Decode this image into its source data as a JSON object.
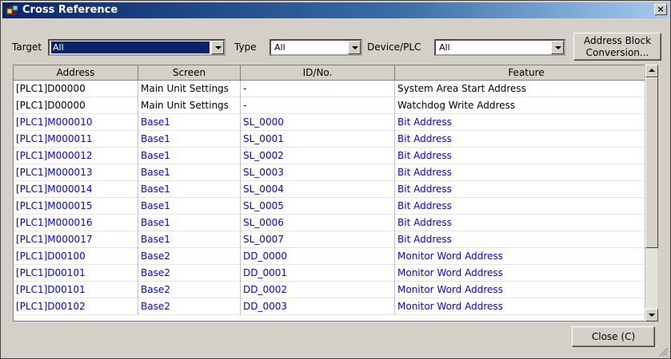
{
  "window": {
    "title": "Cross Reference",
    "close_glyph": "×"
  },
  "filters": {
    "target_label": "Target",
    "target_value": "All",
    "type_label": "Type",
    "type_value": "All",
    "device_label": "Device/PLC",
    "device_value": "All",
    "address_block_button": "Address Block Conversion..."
  },
  "table": {
    "headers": [
      "Address",
      "Screen",
      "ID/No.",
      "Feature"
    ],
    "rows": [
      {
        "address": "[PLC1]D00000",
        "screen": "Main Unit Settings",
        "id": "-",
        "feature": "System Area Start Address",
        "color": "black"
      },
      {
        "address": "[PLC1]D00000",
        "screen": "Main Unit Settings",
        "id": "-",
        "feature": "Watchdog Write Address",
        "color": "black"
      },
      {
        "address": "[PLC1]M000010",
        "screen": "Base1",
        "id": "SL_0000",
        "feature": "Bit Address",
        "color": "blue"
      },
      {
        "address": "[PLC1]M000011",
        "screen": "Base1",
        "id": "SL_0001",
        "feature": "Bit Address",
        "color": "blue"
      },
      {
        "address": "[PLC1]M000012",
        "screen": "Base1",
        "id": "SL_0002",
        "feature": "Bit Address",
        "color": "blue"
      },
      {
        "address": "[PLC1]M000013",
        "screen": "Base1",
        "id": "SL_0003",
        "feature": "Bit Address",
        "color": "blue"
      },
      {
        "address": "[PLC1]M000014",
        "screen": "Base1",
        "id": "SL_0004",
        "feature": "Bit Address",
        "color": "blue"
      },
      {
        "address": "[PLC1]M000015",
        "screen": "Base1",
        "id": "SL_0005",
        "feature": "Bit Address",
        "color": "blue"
      },
      {
        "address": "[PLC1]M000016",
        "screen": "Base1",
        "id": "SL_0006",
        "feature": "Bit Address",
        "color": "blue"
      },
      {
        "address": "[PLC1]M000017",
        "screen": "Base1",
        "id": "SL_0007",
        "feature": "Bit Address",
        "color": "blue"
      },
      {
        "address": "[PLC1]D00100",
        "screen": "Base2",
        "id": "DD_0000",
        "feature": "Monitor Word Address",
        "color": "blue"
      },
      {
        "address": "[PLC1]D00101",
        "screen": "Base2",
        "id": "DD_0001",
        "feature": "Monitor Word Address",
        "color": "blue"
      },
      {
        "address": "[PLC1]D00101",
        "screen": "Base2",
        "id": "DD_0002",
        "feature": "Monitor Word Address",
        "color": "blue"
      },
      {
        "address": "[PLC1]D00102",
        "screen": "Base2",
        "id": "DD_0003",
        "feature": "Monitor Word Address",
        "color": "blue"
      }
    ]
  },
  "footer": {
    "close_button": "Close (C)"
  },
  "colors": {
    "title_gradient_start": "#0a246a",
    "link_blue": "#0000ff",
    "face": "#d4d0c8"
  },
  "icons": {
    "app": "cross-reference-icon",
    "combo": "chevron-down-icon",
    "grip": "resize-grip-icon"
  }
}
